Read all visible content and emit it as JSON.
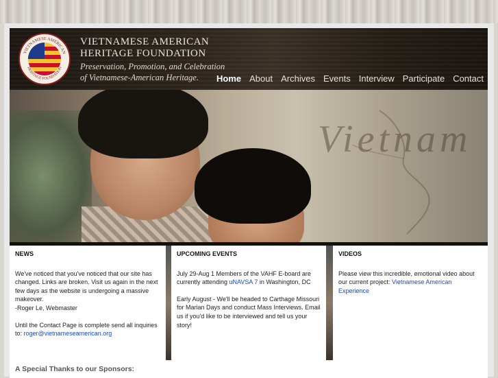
{
  "brand": {
    "line1": "VIETNAMESE AMERICAN",
    "line2": "HERITAGE FOUNDATION",
    "tagline1": "Preservation, Promotion, and Celebration",
    "tagline2": "of Vietnamese-American Heritage.",
    "seal_text_top": "VIETNAMESE AMERICAN",
    "seal_text_bottom": "HERITAGE FOUNDATION"
  },
  "nav": {
    "items": [
      {
        "label": "Home",
        "active": true
      },
      {
        "label": "About"
      },
      {
        "label": "Archives"
      },
      {
        "label": "Events"
      },
      {
        "label": "Interview"
      },
      {
        "label": "Participate"
      },
      {
        "label": "Contact"
      }
    ]
  },
  "hero": {
    "overlay_text": "Vietnam"
  },
  "news": {
    "heading": "NEWS",
    "p1": "We've noticed that you've noticed that our site has changed. Links are broken. Visit us again in the next few days as the website is undergoing a massive makeover.",
    "p1_sign": "-Roger Le, Webmaster",
    "p2_text": "Until the Contact Page is complete send all inquiries to: ",
    "p2_link": "roger@vietnameseamerican.org"
  },
  "events": {
    "heading": "UPCOMING EVENTS",
    "e1_pre": "July 29-Aug 1 Members of the VAHF E-board are currently attending ",
    "e1_link": "uNAVSA 7",
    "e1_post": " in Washington, DC",
    "e2": "Early August - We'll be headed to Carthage Missouri for Marian Days and conduct Mass Interviews. Email us if you'd like to be interviewed and tell us your story!"
  },
  "videos": {
    "heading": "VIDEOS",
    "text": "Please view this incredible, emotional video about our current project: ",
    "link": "Vietnamese American Experience"
  },
  "footer": {
    "thanks": "A Special Thanks to our Sponsors:"
  },
  "colors": {
    "link": "#1a49c9",
    "seal_red": "#c8102e",
    "seal_blue": "#1f3a8a",
    "seal_gold": "#f4c430"
  }
}
